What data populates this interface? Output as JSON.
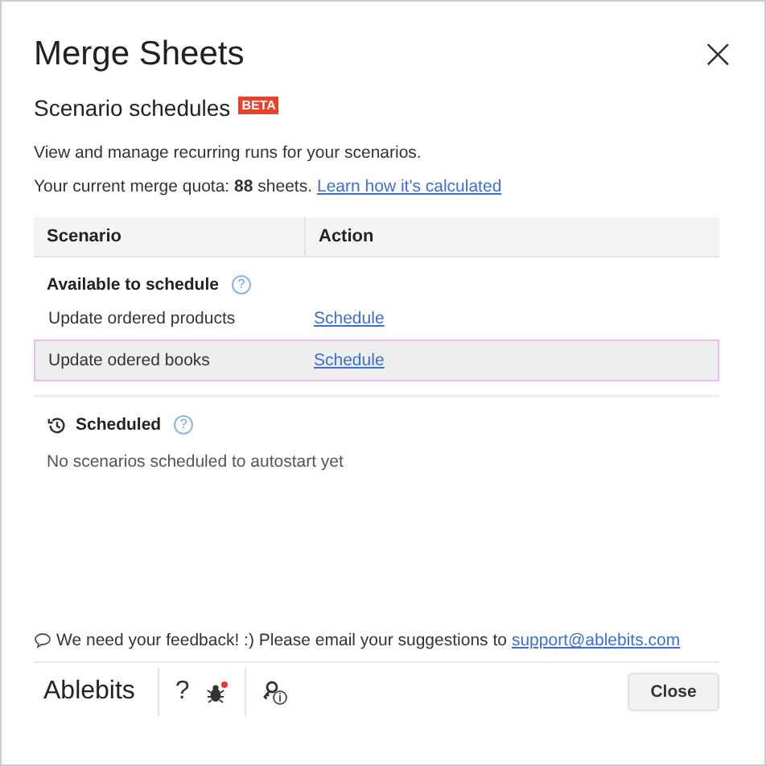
{
  "window": {
    "title": "Merge Sheets",
    "close_icon": "×"
  },
  "section": {
    "title": "Scenario schedules",
    "badge": "BETA"
  },
  "description": "View and manage recurring runs for your scenarios.",
  "quota": {
    "text": "Your current merge quota: **88** sheets.",
    "link": "Learn how it's calculated"
  },
  "table": {
    "columns": [
      "Scenario",
      "Action"
    ],
    "available": {
      "title": "Available to schedule",
      "help": "?",
      "rows": [
        {
          "name": "Update ordered products",
          "action": "Schedule",
          "selected": false
        },
        {
          "name": "Update odered books",
          "action": "Schedule",
          "selected": true
        }
      ]
    },
    "scheduled": {
      "title": "Scheduled",
      "help": "?",
      "empty": "No scenarios scheduled to autostart yet"
    }
  },
  "feedback": {
    "text": "We need your feedback! :) Please email your suggestions to",
    "email": "support@ablebits.com"
  },
  "footer": {
    "brand": "Ablebits",
    "help": "?",
    "bug_notification": true,
    "close": "Close"
  }
}
